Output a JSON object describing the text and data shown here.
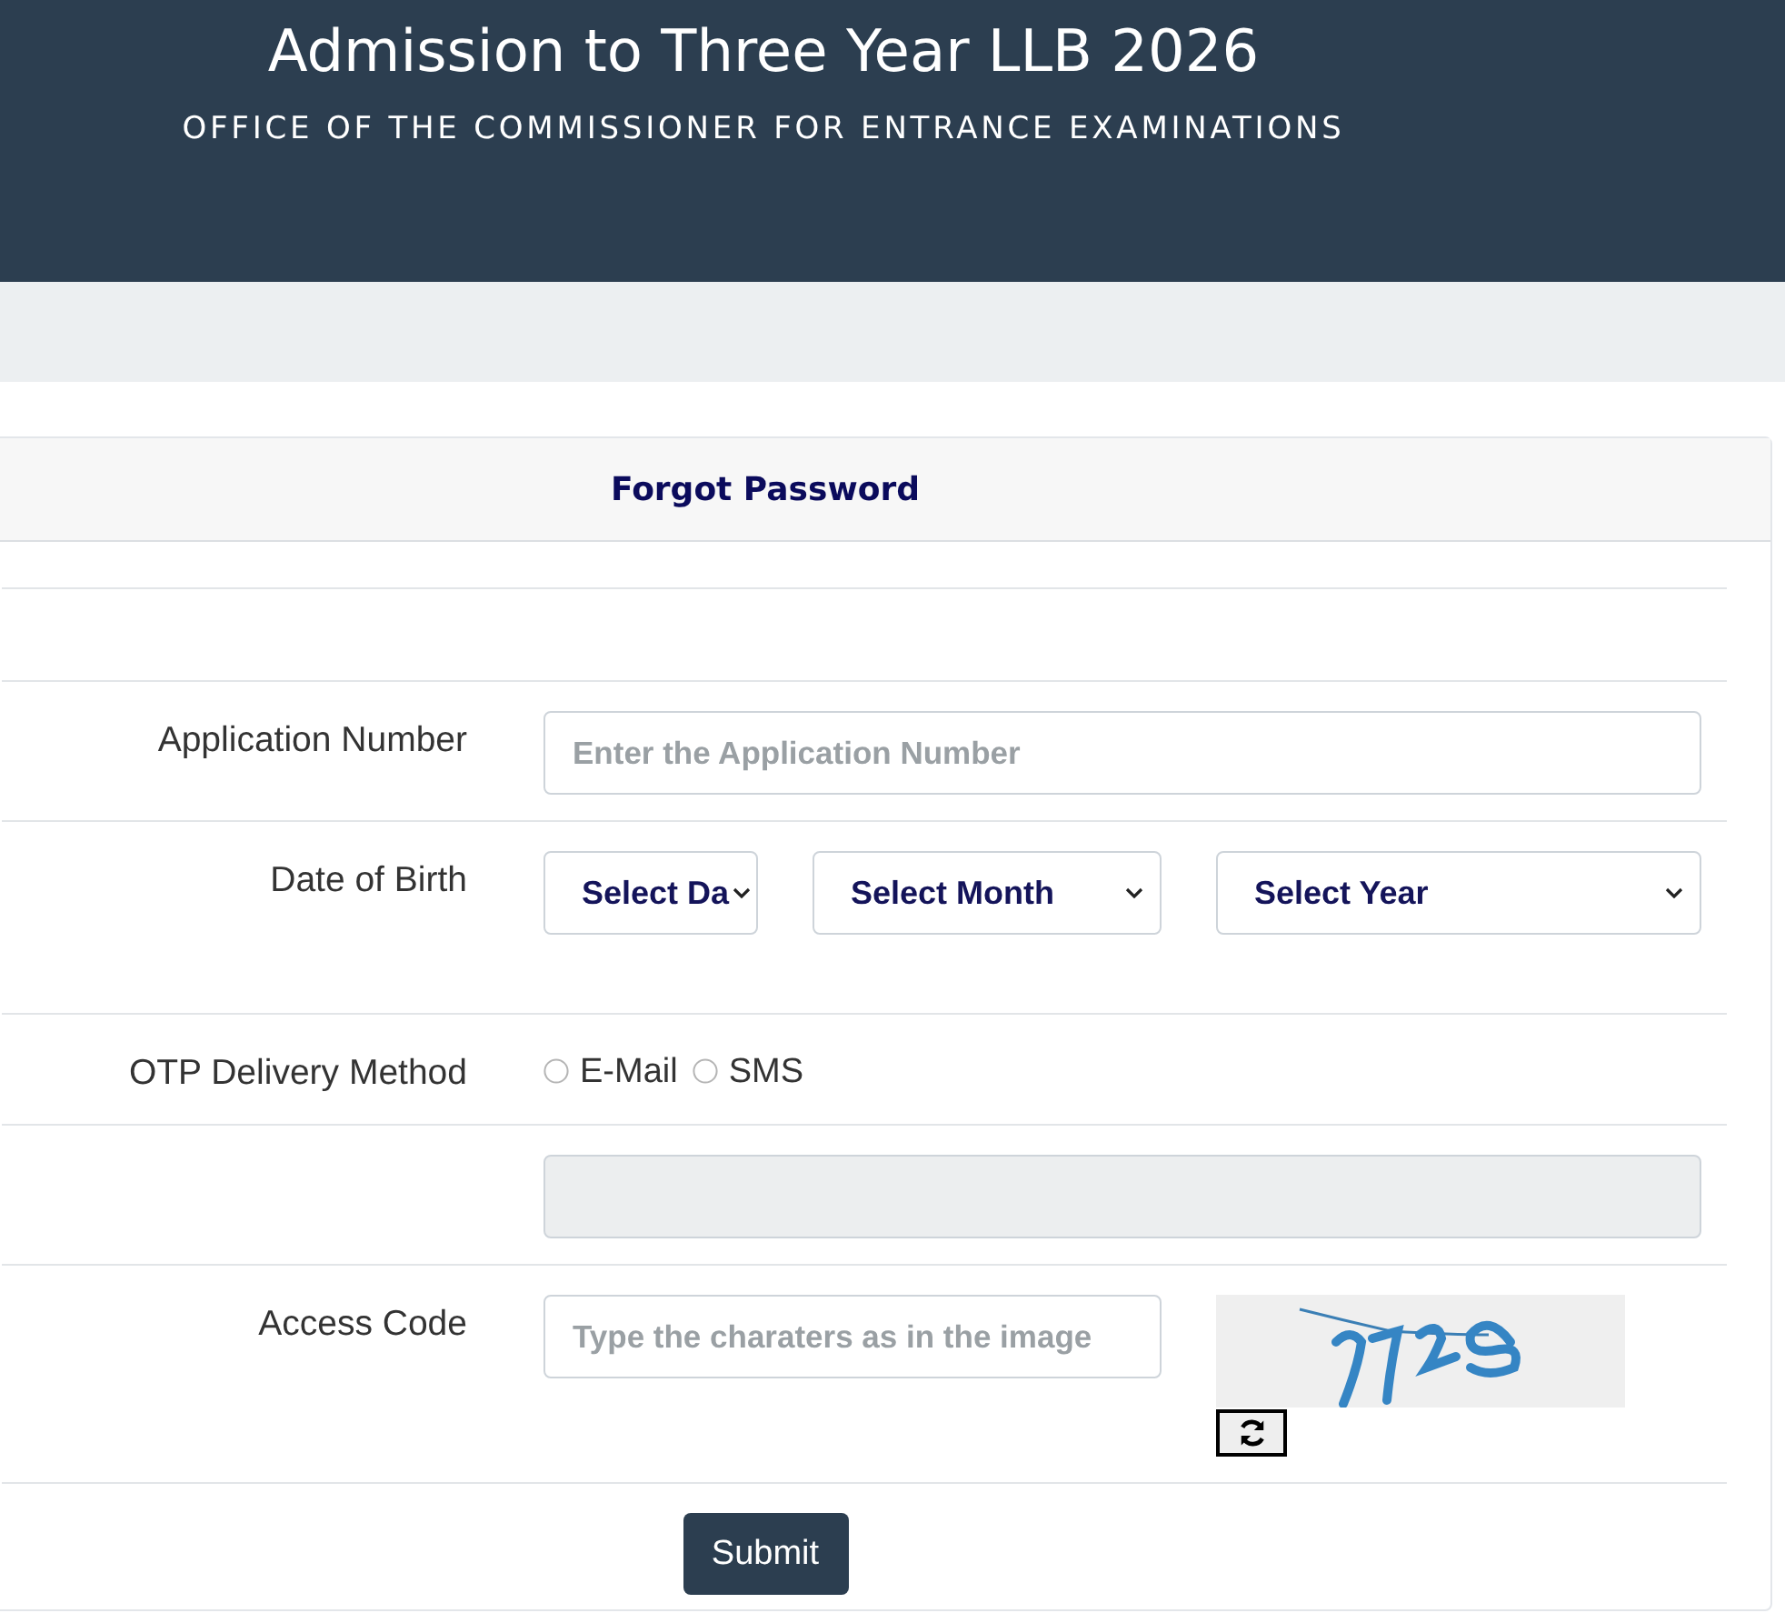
{
  "header": {
    "title": "Admission to Three Year LLB 2026",
    "subtitle": "OFFICE OF THE COMMISSIONER FOR ENTRANCE EXAMINATIONS"
  },
  "card": {
    "title": "Forgot Password"
  },
  "fields": [
    {
      "kind": "text",
      "label": "Application Number",
      "placeholder": "Enter the Application Number",
      "disabled": false
    },
    {
      "kind": "date",
      "label": "Date of Birth",
      "selects": [
        "Select Da",
        "Select Month",
        "Select Year"
      ],
      "disabled": false
    },
    {
      "kind": "radio",
      "label": "OTP Delivery Method",
      "options": [
        {
          "label": "E-Mail",
          "selected": false
        },
        {
          "label": "SMS",
          "selected": false
        }
      ],
      "disabled": false
    },
    {
      "kind": "text",
      "disabled": true
    },
    {
      "kind": "captcha",
      "label": "Access Code",
      "placeholder": "Type the charaters as in the image",
      "disabled": false
    }
  ],
  "submit": "Submit"
}
